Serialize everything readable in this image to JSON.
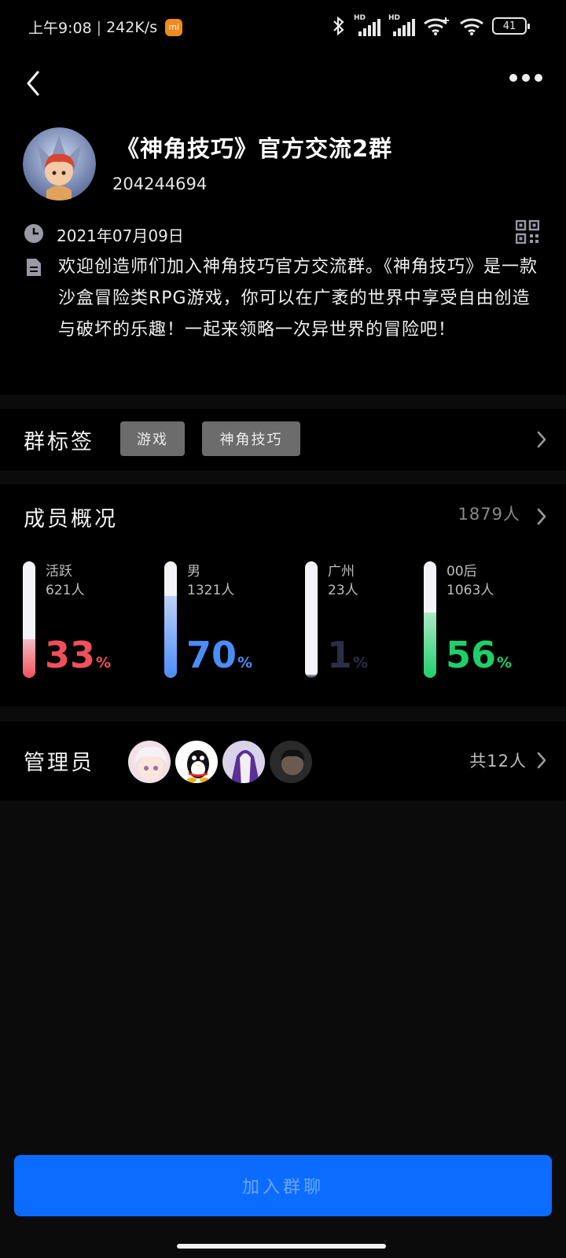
{
  "status_bar": {
    "time": "上午9:08",
    "speed": "242K/s",
    "mi_badge": "mi",
    "hd1": "HD",
    "hd2": "HD",
    "battery": "41"
  },
  "group": {
    "name": "《神角技巧》官方交流2群",
    "id": "204244694",
    "created_date": "2021年07月09日",
    "description": "欢迎创造师们加入神角技巧官方交流群。《神角技巧》是一款沙盒冒险类RPG游戏，你可以在广袤的世界中享受自由创造与破坏的乐趣！一起来领略一次异世界的冒险吧！"
  },
  "tags_section": {
    "title": "群标签",
    "tags": [
      "游戏",
      "神角技巧"
    ]
  },
  "members_section": {
    "title": "成员概况",
    "total": "1879人",
    "stats": [
      {
        "label": "活跃",
        "count": "621人",
        "percent": "33",
        "unit": "%",
        "fraction": 0.33,
        "color": "#f0505c"
      },
      {
        "label": "男",
        "count": "1321人",
        "percent": "70",
        "unit": "%",
        "fraction": 0.7,
        "color": "#4b8df8"
      },
      {
        "label": "广州",
        "count": "23人",
        "percent": "1",
        "unit": "%",
        "fraction": 0.01,
        "color": "#2b2f45"
      },
      {
        "label": "00后",
        "count": "1063人",
        "percent": "56",
        "unit": "%",
        "fraction": 0.56,
        "color": "#1fcf6a"
      }
    ]
  },
  "admins_section": {
    "title": "管理员",
    "total": "共12人"
  },
  "join_button": "加入群聊"
}
